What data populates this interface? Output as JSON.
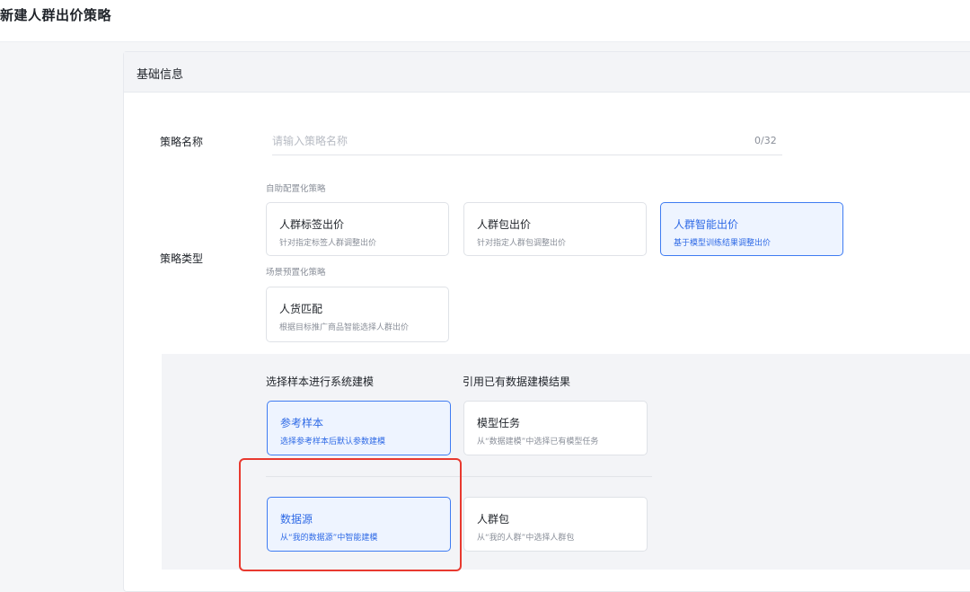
{
  "page": {
    "title": "新建人群出价策略"
  },
  "section": {
    "title": "基础信息"
  },
  "strategy_name": {
    "label": "策略名称",
    "placeholder": "请输入策略名称",
    "value": "",
    "counter": "0/32"
  },
  "strategy_type": {
    "label": "策略类型",
    "groups": [
      {
        "label": "自助配置化策略",
        "options": [
          {
            "title": "人群标签出价",
            "desc": "针对指定标签人群调整出价",
            "selected": false
          },
          {
            "title": "人群包出价",
            "desc": "针对指定人群包调整出价",
            "selected": false
          },
          {
            "title": "人群智能出价",
            "desc": "基于模型训练结果调整出价",
            "selected": true
          }
        ]
      },
      {
        "label": "场景预置化策略",
        "options": [
          {
            "title": "人货匹配",
            "desc": "根据目标推广商品智能选择人群出价",
            "selected": false
          }
        ]
      }
    ]
  },
  "modeling": {
    "left_label": "选择样本进行系统建模",
    "right_label": "引用已有数据建模结果",
    "options": [
      {
        "title": "参考样本",
        "desc": "选择参考样本后默认参数建模",
        "selected": true
      },
      {
        "title": "模型任务",
        "desc": "从“数据建模”中选择已有模型任务",
        "selected": false
      },
      {
        "title": "数据源",
        "desc": "从“我的数据源”中智能建模",
        "selected": true
      },
      {
        "title": "人群包",
        "desc": "从“我的人群”中选择人群包",
        "selected": false
      }
    ]
  },
  "colors": {
    "accent": "#3f7cf2",
    "selected_bg": "#eef4ff",
    "highlight": "#e8392f"
  }
}
